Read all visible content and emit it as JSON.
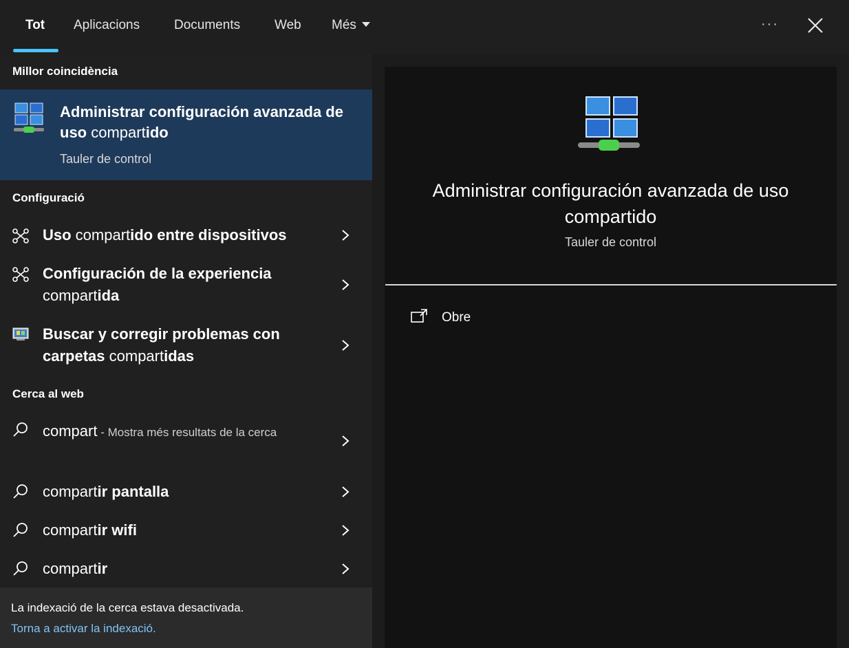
{
  "tabs": {
    "all": "Tot",
    "apps": "Aplicacions",
    "documents": "Documents",
    "web": "Web",
    "more": "Més"
  },
  "header": {
    "more_options": "···"
  },
  "sections": {
    "best_match": "Millor coincidència",
    "settings": "Configuració",
    "web_search": "Cerca al web"
  },
  "best_match": {
    "title_bold_1": "Administrar configuración avanzada de uso",
    "title_normal": " compart",
    "title_bold_2": "ido",
    "subtitle": "Tauler de control"
  },
  "settings_items": [
    {
      "bold": "Uso",
      "normal": " compart",
      "bold2": "ido entre dispositivos",
      "icon": "share-devices-icon"
    },
    {
      "bold": "Configuración de la experiencia",
      "normal": "compart",
      "bold2": "ida",
      "icon": "share-devices-icon"
    },
    {
      "bold": "Buscar y corregir problemas con carpetas",
      "normal": " compart",
      "bold2": "idas",
      "icon": "troubleshoot-icon"
    }
  ],
  "web_items": [
    {
      "text": "compart",
      "suffix": " - Mostra més resultats de la cerca"
    },
    {
      "normal": "compart",
      "bold": "ir pantalla"
    },
    {
      "normal": "compart",
      "bold": "ir wifi"
    },
    {
      "normal": "compart",
      "bold": "ir"
    }
  ],
  "footer": {
    "message": "La indexació de la cerca estava desactivada.",
    "link": "Torna a activar la indexació."
  },
  "detail": {
    "title": "Administrar configuración avanzada de uso compartido",
    "subtitle": "Tauler de control",
    "open_label": "Obre"
  },
  "colors": {
    "accent": "#4cc2ff",
    "selected_bg": "#1e3a5a",
    "link": "#7fc4f5"
  }
}
